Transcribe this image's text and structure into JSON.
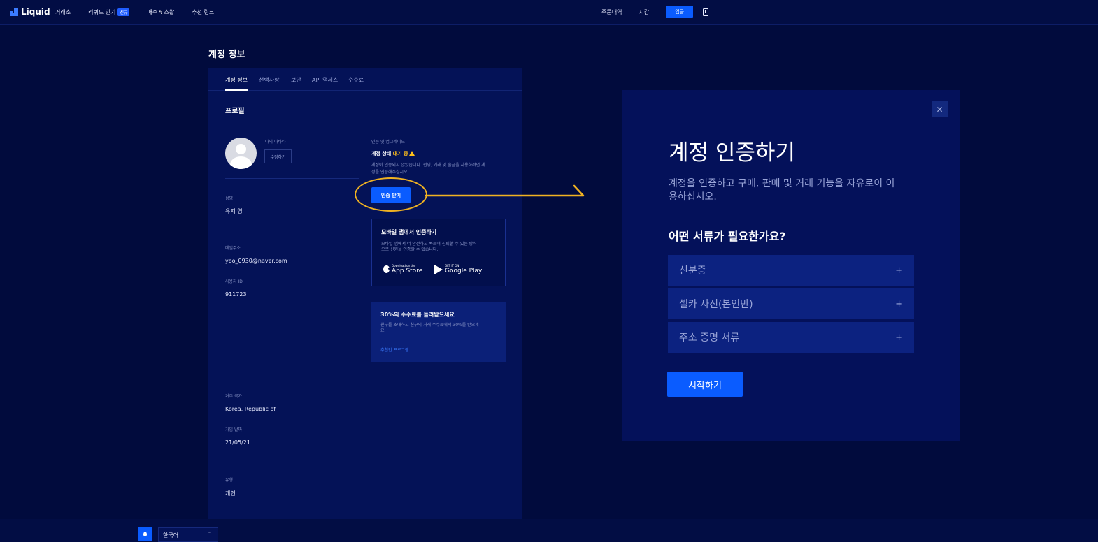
{
  "nav": {
    "logo": "Liquid",
    "left_items": [
      "거래소",
      "리퀴드 인기",
      "매수",
      "스왑",
      "추천 링크"
    ],
    "new_badge": "신규",
    "right_items": [
      "주문내역",
      "지갑"
    ],
    "deposit_label": "입금"
  },
  "page": {
    "title": "계정 정보"
  },
  "tabs": [
    "계정 정보",
    "선택사항",
    "보안",
    "API 액세스",
    "수수료"
  ],
  "profile": {
    "section_title": "프로필",
    "avatar_label": "나의 아바타",
    "edit_label": "수정하기",
    "name_label": "성명",
    "name_value": "유지 영",
    "email_label": "메일주소",
    "email_value": "yoo_0930@naver.com",
    "user_id_label": "사용자 ID",
    "user_id_value": "911723",
    "country_label": "거주 국가",
    "country_value": "Korea, Republic of",
    "joined_label": "가입 날짜",
    "joined_value": "21/05/21",
    "type_label": "유형",
    "type_value": "개인"
  },
  "verification": {
    "section_label": "인증 및 업그레이드",
    "status_prefix": "계정 상태",
    "status_value": "대기 중",
    "desc_line1": "계정이 인증되지 않았습니다. 펀딩, 거래 및 출금을 사용하려면 계",
    "desc_line2": "정을 인증해주십시오.",
    "verify_button": "인증 받기"
  },
  "mobile_box": {
    "title": "모바일 앱에서 인증하기",
    "desc_line1": "모바일 앱에서 더 안전하고 빠르며 신뢰할 수 있는 방식",
    "desc_line2": "으로 신원을 인증할 수 있습니다.",
    "appstore_small": "Download on the",
    "appstore_big": "App Store",
    "gplay_small": "GET IT ON",
    "gplay_big": "Google Play"
  },
  "referral_box": {
    "title": "30%의 수수료를 돌려받으세요",
    "desc_line1": "친구를 초대하고 친구의 거래 수수료에서 30%를 받으세",
    "desc_line2": "요.",
    "link": "추천인 프로그램"
  },
  "modal": {
    "close_symbol": "✕",
    "title": "계정 인증하기",
    "desc_line1": "계정을 인증하고 구매, 판매 및 거래 기능을 자유로이 이",
    "desc_line2": "용하십시오.",
    "question": "어떤 서류가 필요한가요?",
    "docs": [
      "신분증",
      "셀카 사진(본인만)",
      "주소 증명 서류"
    ],
    "plus_symbol": "+",
    "start_button": "시작하기"
  },
  "footer": {
    "language": "한국어",
    "chevron": "⌃"
  },
  "colors": {
    "background": "#010b3d",
    "card": "#041257",
    "accent": "#0a5cff",
    "pending": "#ffbf1a",
    "annotation": "#f0b222"
  },
  "icons": [
    "logo-icon",
    "bolt-icon",
    "phone-icon",
    "warning-icon",
    "apple-icon",
    "google-play-icon",
    "close-icon",
    "plus-icon",
    "drop-icon",
    "chevron-up-icon"
  ]
}
